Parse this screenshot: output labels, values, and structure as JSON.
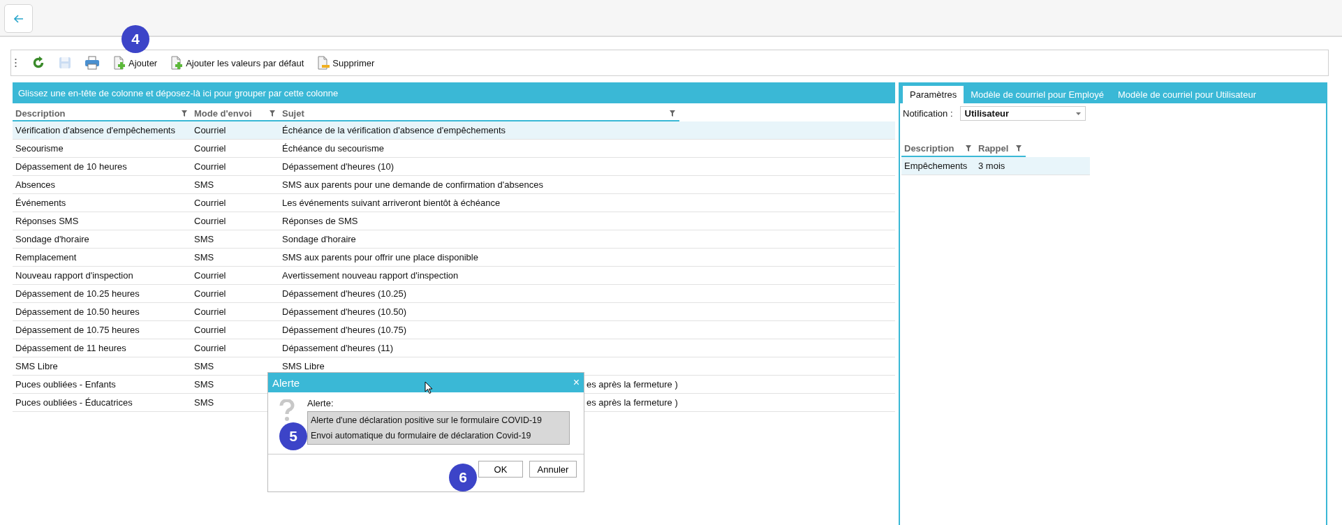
{
  "toolbar": {
    "callout": "4",
    "items": [
      {
        "kind": "refresh",
        "disabled": false
      },
      {
        "kind": "save",
        "disabled": true
      },
      {
        "kind": "print",
        "disabled": false
      },
      {
        "kind": "add",
        "label": "Ajouter",
        "disabled": false
      },
      {
        "kind": "add",
        "label": "Ajouter les valeurs par défaut",
        "disabled": false
      },
      {
        "kind": "delete",
        "label": "Supprimer",
        "disabled": false
      }
    ]
  },
  "grid": {
    "group_hint": "Glissez une en-tête de colonne et déposez-là ici pour grouper par cette colonne",
    "columns": [
      "Description",
      "Mode d'envoi",
      "Sujet"
    ],
    "rows": [
      {
        "description": "Vérification d'absence d'empêchements",
        "mode": "Courriel",
        "subject": "Échéance de la vérification d'absence d'empêchements",
        "selected": true,
        "covered": false
      },
      {
        "description": "Secourisme",
        "mode": "Courriel",
        "subject": "Échéance du secourisme",
        "selected": false,
        "covered": false
      },
      {
        "description": "Dépassement de 10 heures",
        "mode": "Courriel",
        "subject": "Dépassement d'heures (10)",
        "selected": false,
        "covered": false
      },
      {
        "description": "Absences",
        "mode": "SMS",
        "subject": "SMS aux parents pour une demande de confirmation d'absences",
        "selected": false,
        "covered": false
      },
      {
        "description": "Événements",
        "mode": "Courriel",
        "subject": "Les événements suivant arriveront bientôt à échéance",
        "selected": false,
        "covered": false
      },
      {
        "description": "Réponses SMS",
        "mode": "Courriel",
        "subject": "Réponses de SMS",
        "selected": false,
        "covered": false
      },
      {
        "description": "Sondage d'horaire",
        "mode": "SMS",
        "subject": "Sondage d'horaire",
        "selected": false,
        "covered": false
      },
      {
        "description": "Remplacement",
        "mode": "SMS",
        "subject": "SMS aux parents pour offrir une place disponible",
        "selected": false,
        "covered": false
      },
      {
        "description": "Nouveau rapport d'inspection",
        "mode": "Courriel",
        "subject": "Avertissement nouveau rapport d'inspection",
        "selected": false,
        "covered": false
      },
      {
        "description": "Dépassement de 10.25 heures",
        "mode": "Courriel",
        "subject": "Dépassement d'heures (10.25)",
        "selected": false,
        "covered": false
      },
      {
        "description": "Dépassement de 10.50 heures",
        "mode": "Courriel",
        "subject": "Dépassement d'heures (10.50)",
        "selected": false,
        "covered": false
      },
      {
        "description": "Dépassement de 10.75 heures",
        "mode": "Courriel",
        "subject": "Dépassement d'heures (10.75)",
        "selected": false,
        "covered": false
      },
      {
        "description": "Dépassement de 11 heures",
        "mode": "Courriel",
        "subject": "Dépassement d'heures (11)",
        "selected": false,
        "covered": false
      },
      {
        "description": "SMS Libre",
        "mode": "SMS",
        "subject": "SMS Libre",
        "selected": false,
        "covered": false
      },
      {
        "description": "Puces oubliées - Enfants",
        "mode": "SMS",
        "subject": "es après la fermeture )",
        "selected": false,
        "covered": true
      },
      {
        "description": "Puces oubliées - Éducatrices",
        "mode": "SMS",
        "subject": "es après la fermeture )",
        "selected": false,
        "covered": true
      }
    ]
  },
  "right_panel": {
    "tabs": [
      {
        "label": "Paramètres",
        "selected": true
      },
      {
        "label": "Modèle de courriel pour Employé",
        "selected": false
      },
      {
        "label": "Modèle de courriel pour Utilisateur",
        "selected": false
      }
    ],
    "notification": {
      "label": "Notification :",
      "value": "Utilisateur"
    },
    "table": {
      "columns": [
        "Description",
        "Rappel"
      ],
      "rows": [
        {
          "description": "Empêchements",
          "reminder": "3 mois",
          "selected": true
        }
      ]
    }
  },
  "dialog": {
    "title": "Alerte",
    "close": "×",
    "label": "Alerte:",
    "items": [
      "Alerte d'une déclaration positive sur le formulaire COVID-19",
      "Envoi automatique du formulaire de déclaration Covid-19"
    ],
    "callout": "5",
    "buttons": [
      "OK",
      "Annuler"
    ],
    "buttons_callout": "6"
  }
}
